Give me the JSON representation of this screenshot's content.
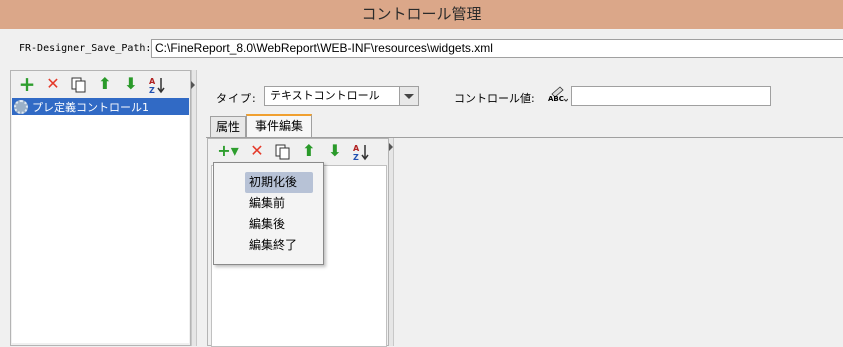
{
  "window": {
    "title": "コントロール管理"
  },
  "path": {
    "label": "FR-Designer_Save_Path:",
    "value": "C:\\FineReport_8.0\\WebReport\\WEB-INF\\resources\\widgets.xml"
  },
  "left_toolbar": {
    "icons": [
      "add-icon",
      "delete-icon",
      "copy-icon",
      "move-up-icon",
      "move-down-icon",
      "sort-az-icon"
    ],
    "add": "+",
    "delete": "✕",
    "up": "⬆",
    "down": "⬇",
    "sort": "A Z"
  },
  "tree": {
    "items": [
      {
        "label": "プレ定義コントロール1",
        "selected": true
      }
    ]
  },
  "type": {
    "label": "タイプ:",
    "value": "テキストコントロール"
  },
  "control_value": {
    "label": "コントロール値:",
    "icon": "abc-edit-icon",
    "abc": "ABC"
  },
  "tabs": [
    {
      "label": "属性"
    },
    {
      "label": "事件編集",
      "active": true
    }
  ],
  "event_toolbar": {
    "add": "+▾",
    "delete": "✕",
    "up": "⬆",
    "down": "⬇",
    "sort": "A Z"
  },
  "context_menu": {
    "items": [
      {
        "label": "初期化後",
        "selected": true
      },
      {
        "label": "編集前"
      },
      {
        "label": "編集後"
      },
      {
        "label": "編集終了"
      }
    ]
  },
  "colors": {
    "titlebar": "#dba789",
    "selection": "#316ac5",
    "tab_accent": "#f0a030"
  }
}
